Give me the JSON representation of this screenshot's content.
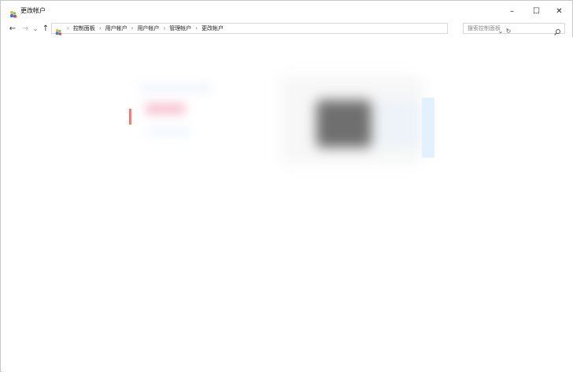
{
  "window": {
    "title": "更改帐户",
    "controls": {
      "minimize": "–",
      "maximize": "☐",
      "close": "✕"
    }
  },
  "toolbar": {
    "back": "←",
    "forward": "→",
    "recent": "⌄",
    "up": "↑",
    "dropdown": "⌄",
    "refresh": "↻"
  },
  "address": {
    "crumbs": [
      "控制面板",
      "用户帐户",
      "用户帐户",
      "管理帐户",
      "更改帐户"
    ],
    "separator": "›"
  },
  "search": {
    "placeholder": "搜索控制面板"
  },
  "colors": {
    "accent_red": "#e02727",
    "accent_blue": "#2b7cd3"
  }
}
